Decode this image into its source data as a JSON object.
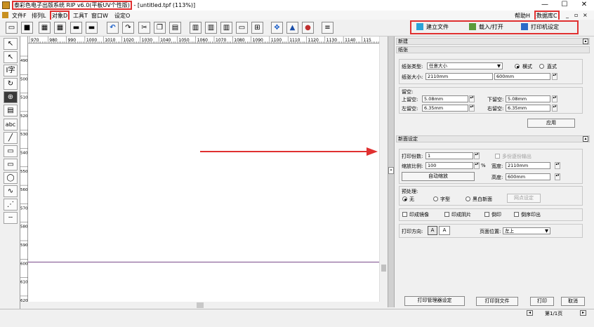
{
  "title": {
    "prefix": "泰彩色电子出版系统 RIP v6.0(平板UV个性版)",
    "suffix": "- [untitled.tpf (113%)]",
    "min": "—",
    "max": "☐",
    "close": "✕"
  },
  "menu": {
    "items": [
      "文件F",
      "排列L",
      "对象D",
      "工具T",
      "窗口W",
      "设定O"
    ],
    "help": "帮助H",
    "db": "数据库C",
    "sub_min": "_",
    "sub_max": "▫",
    "sub_close": "×"
  },
  "tabs": {
    "new_file": "建立文件",
    "load_open": "载入/打开",
    "printer_settings": "打印机设定"
  },
  "ruler": {
    "h": [
      "970",
      "980",
      "990",
      "1000",
      "1010",
      "1020",
      "1030",
      "1040",
      "1050",
      "1060",
      "1070",
      "1080",
      "1090",
      "1100",
      "1110",
      "1120",
      "1130",
      "1140",
      "115"
    ],
    "v": [
      "490",
      "500",
      "510",
      "520",
      "530",
      "540",
      "550",
      "560",
      "570",
      "580",
      "590",
      "600",
      "610",
      "620"
    ]
  },
  "panel": {
    "new_header": "新建",
    "paper_header": "纸张",
    "paper_type_label": "纸张类型:",
    "paper_type_value": "任意大小",
    "landscape": "横式",
    "portrait": "直式",
    "paper_size_label": "纸张大小:",
    "paper_width": "2110mm",
    "paper_height": "600mm",
    "margin_title": "留空:",
    "top_label": "上留空:",
    "top_value": "5.08mm",
    "bottom_label": "下留空:",
    "bottom_value": "5.08mm",
    "left_label": "左留空:",
    "left_value": "6.35mm",
    "right_label": "右留空:",
    "right_value": "6.35mm",
    "apply": "应用",
    "page_header": "新面设定",
    "copies_label": "打印份数:",
    "copies_value": "1",
    "collate": "多份逐份输出",
    "scale_label": "缩放比例:",
    "scale_value": "100",
    "scale_unit": "%",
    "width_label": "宽度:",
    "width_value": "2110mm",
    "auto_scale": "自动缩放",
    "height_label": "高度:",
    "height_value": "600mm",
    "preprocess": "预处理:",
    "pre_none": "无",
    "pre_font": "字型",
    "pre_bw": "黑白新面",
    "halftone": "网点设定",
    "mirror": "印成镜像",
    "negative": "印成阴片",
    "invert": "倒印",
    "reverse": "倒序印出",
    "orient_label": "打印方向:",
    "position_label": "页面位置:",
    "position_value": "左上",
    "print_manager": "打印管理器设定",
    "print_to_file": "打印到文件",
    "print": "打印",
    "cancel": "取消"
  },
  "status": {
    "page": "第1/1页"
  }
}
